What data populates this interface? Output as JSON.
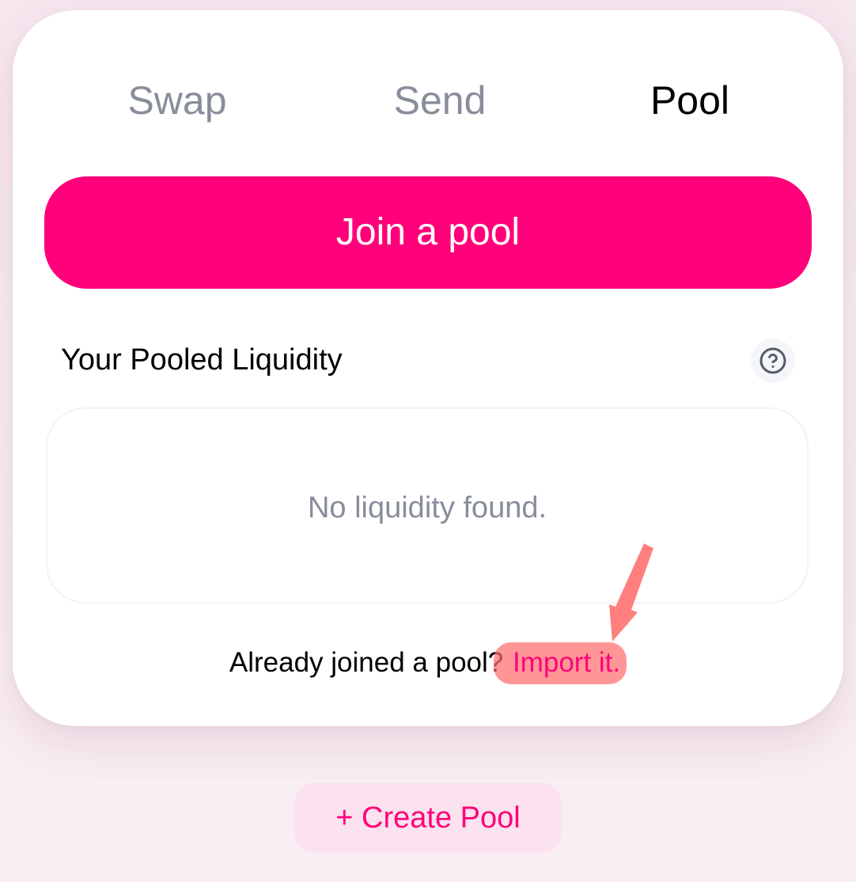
{
  "tabs": [
    {
      "label": "Swap",
      "active": false
    },
    {
      "label": "Send",
      "active": false
    },
    {
      "label": "Pool",
      "active": true
    }
  ],
  "join_button": {
    "label": "Join a pool"
  },
  "liquidity": {
    "title": "Your Pooled Liquidity",
    "help_icon": "question-circle-icon",
    "empty_message": "No liquidity found."
  },
  "import": {
    "prompt": "Already joined a pool? ",
    "link": "Import it."
  },
  "annotation": {
    "icon": "arrow-down-icon",
    "color": "#ff7f7f"
  },
  "create_pool": {
    "label": "+ Create Pool"
  },
  "colors": {
    "accent": "#ff007a",
    "muted_text": "#888d9b",
    "card_background": "#ffffff",
    "page_background": "#f6e6ee"
  }
}
